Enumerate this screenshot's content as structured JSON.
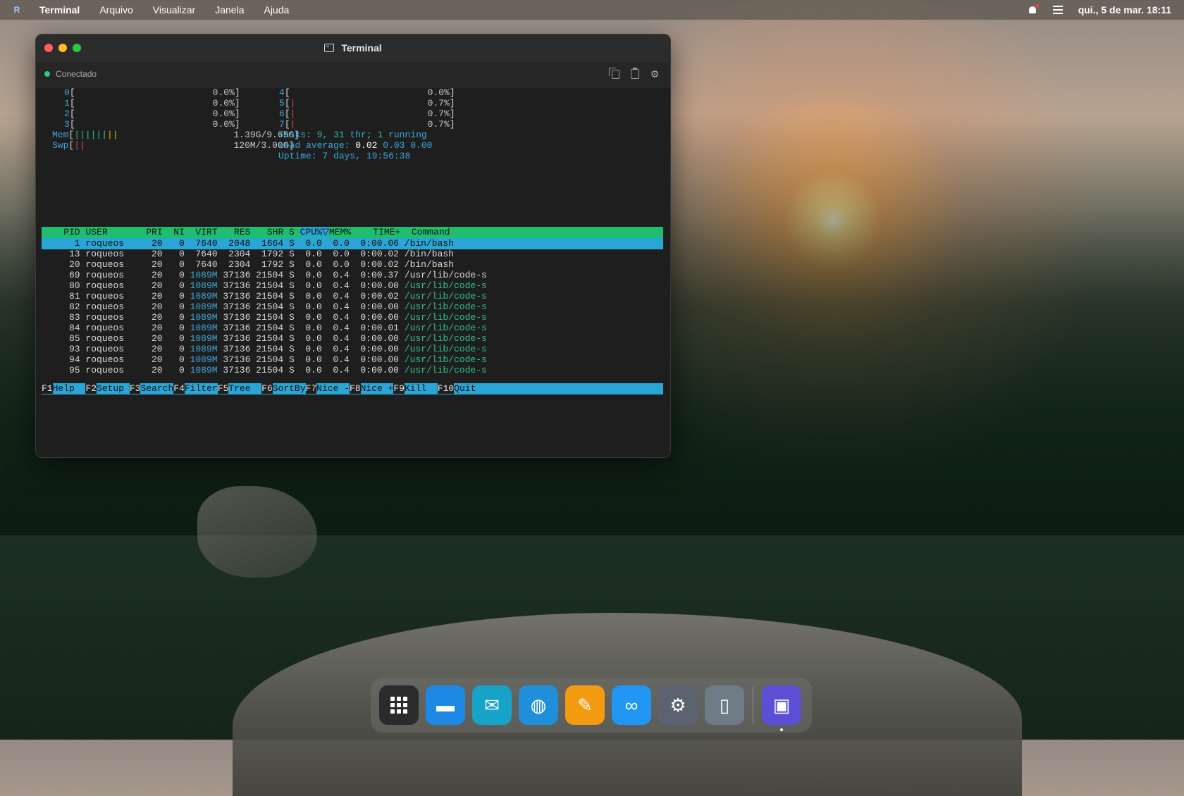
{
  "menubar": {
    "app": "Terminal",
    "items": [
      "Arquivo",
      "Visualizar",
      "Janela",
      "Ajuda"
    ],
    "clock": "qui., 5 de mar. 18:11"
  },
  "window": {
    "title": "Terminal",
    "status": "Conectado"
  },
  "htop": {
    "cpus_left": [
      {
        "id": "0",
        "pct": "0.0%"
      },
      {
        "id": "1",
        "pct": "0.0%"
      },
      {
        "id": "2",
        "pct": "0.0%"
      },
      {
        "id": "3",
        "pct": "0.0%"
      }
    ],
    "cpus_right": [
      {
        "id": "4",
        "pct": "0.0%"
      },
      {
        "id": "5",
        "pct": "0.7%"
      },
      {
        "id": "6",
        "pct": "0.7%"
      },
      {
        "id": "7",
        "pct": "0.7%"
      }
    ],
    "mem_label": "Mem",
    "mem": "1.39G/9.65G",
    "swp_label": "Swp",
    "swp": "120M/3.00G",
    "tasks_label": "Tasks: ",
    "tasks": "9",
    "thr": "31",
    "thr_label": " thr; ",
    "running": "1",
    "running_label": " running",
    "load_label": "Load average: ",
    "load1": "0.02",
    "load5": "0.03",
    "load15": "0.00",
    "uptime_label": "Uptime: ",
    "uptime": "7 days, 19:56:38",
    "header": "    PID USER       PRI  NI  VIRT   RES   SHR S ",
    "header_cpu": "CPU%▽",
    "header_rest": "MEM%    TIME+  Command",
    "processes": [
      {
        "pid": "1",
        "user": "roqueos",
        "pri": "20",
        "ni": "0",
        "virt": "7640",
        "res": "2048",
        "shr": "1664",
        "s": "S",
        "cpu": "0.0",
        "mem": "0.0",
        "time": "0:00.06",
        "cmd": "/bin/bash"
      },
      {
        "pid": "13",
        "user": "roqueos",
        "pri": "20",
        "ni": "0",
        "virt": "7640",
        "res": "2304",
        "shr": "1792",
        "s": "S",
        "cpu": "0.0",
        "mem": "0.0",
        "time": "0:00.02",
        "cmd": "/bin/bash"
      },
      {
        "pid": "20",
        "user": "roqueos",
        "pri": "20",
        "ni": "0",
        "virt": "7640",
        "res": "2304",
        "shr": "1792",
        "s": "S",
        "cpu": "0.0",
        "mem": "0.0",
        "time": "0:00.02",
        "cmd": "/bin/bash"
      },
      {
        "pid": "69",
        "user": "roqueos",
        "pri": "20",
        "ni": "0",
        "virt": "1089M",
        "res": "37136",
        "shr": "21504",
        "s": "S",
        "cpu": "0.0",
        "mem": "0.4",
        "time": "0:00.37",
        "cmd": "/usr/lib/code-s"
      },
      {
        "pid": "80",
        "user": "roqueos",
        "pri": "20",
        "ni": "0",
        "virt": "1089M",
        "res": "37136",
        "shr": "21504",
        "s": "S",
        "cpu": "0.0",
        "mem": "0.4",
        "time": "0:00.00",
        "cmd": "/usr/lib/code-s"
      },
      {
        "pid": "81",
        "user": "roqueos",
        "pri": "20",
        "ni": "0",
        "virt": "1089M",
        "res": "37136",
        "shr": "21504",
        "s": "S",
        "cpu": "0.0",
        "mem": "0.4",
        "time": "0:00.02",
        "cmd": "/usr/lib/code-s"
      },
      {
        "pid": "82",
        "user": "roqueos",
        "pri": "20",
        "ni": "0",
        "virt": "1089M",
        "res": "37136",
        "shr": "21504",
        "s": "S",
        "cpu": "0.0",
        "mem": "0.4",
        "time": "0:00.00",
        "cmd": "/usr/lib/code-s"
      },
      {
        "pid": "83",
        "user": "roqueos",
        "pri": "20",
        "ni": "0",
        "virt": "1089M",
        "res": "37136",
        "shr": "21504",
        "s": "S",
        "cpu": "0.0",
        "mem": "0.4",
        "time": "0:00.00",
        "cmd": "/usr/lib/code-s"
      },
      {
        "pid": "84",
        "user": "roqueos",
        "pri": "20",
        "ni": "0",
        "virt": "1089M",
        "res": "37136",
        "shr": "21504",
        "s": "S",
        "cpu": "0.0",
        "mem": "0.4",
        "time": "0:00.01",
        "cmd": "/usr/lib/code-s"
      },
      {
        "pid": "85",
        "user": "roqueos",
        "pri": "20",
        "ni": "0",
        "virt": "1089M",
        "res": "37136",
        "shr": "21504",
        "s": "S",
        "cpu": "0.0",
        "mem": "0.4",
        "time": "0:00.00",
        "cmd": "/usr/lib/code-s"
      },
      {
        "pid": "93",
        "user": "roqueos",
        "pri": "20",
        "ni": "0",
        "virt": "1089M",
        "res": "37136",
        "shr": "21504",
        "s": "S",
        "cpu": "0.0",
        "mem": "0.4",
        "time": "0:00.00",
        "cmd": "/usr/lib/code-s"
      },
      {
        "pid": "94",
        "user": "roqueos",
        "pri": "20",
        "ni": "0",
        "virt": "1089M",
        "res": "37136",
        "shr": "21504",
        "s": "S",
        "cpu": "0.0",
        "mem": "0.4",
        "time": "0:00.00",
        "cmd": "/usr/lib/code-s"
      },
      {
        "pid": "95",
        "user": "roqueos",
        "pri": "20",
        "ni": "0",
        "virt": "1089M",
        "res": "37136",
        "shr": "21504",
        "s": "S",
        "cpu": "0.0",
        "mem": "0.4",
        "time": "0:00.00",
        "cmd": "/usr/lib/code-s"
      }
    ],
    "fkeys": [
      {
        "key": "F1",
        "label": "Help  "
      },
      {
        "key": "F2",
        "label": "Setup "
      },
      {
        "key": "F3",
        "label": "Search"
      },
      {
        "key": "F4",
        "label": "Filter"
      },
      {
        "key": "F5",
        "label": "Tree  "
      },
      {
        "key": "F6",
        "label": "SortBy"
      },
      {
        "key": "F7",
        "label": "Nice -"
      },
      {
        "key": "F8",
        "label": "Nice +"
      },
      {
        "key": "F9",
        "label": "Kill  "
      },
      {
        "key": "F10",
        "label": "Quit"
      }
    ]
  },
  "dock": [
    {
      "name": "app-grid",
      "color": "#2b2b2b",
      "icon": "grid-icon"
    },
    {
      "name": "files",
      "color": "#1e88e5",
      "icon": "folder-icon"
    },
    {
      "name": "messages",
      "color": "#17a2c8",
      "icon": "chat-icon"
    },
    {
      "name": "browser",
      "color": "#1e8fd8",
      "icon": "globe-icon"
    },
    {
      "name": "notes",
      "color": "#f39c12",
      "icon": "note-icon"
    },
    {
      "name": "links",
      "color": "#2196f3",
      "icon": "link-icon"
    },
    {
      "name": "settings",
      "color": "#5b6370",
      "icon": "gear-icon"
    },
    {
      "name": "trash",
      "color": "#6f7b86",
      "icon": "trash-icon"
    },
    {
      "name": "terminal",
      "color": "#5b4fd6",
      "icon": "terminal-icon"
    }
  ]
}
